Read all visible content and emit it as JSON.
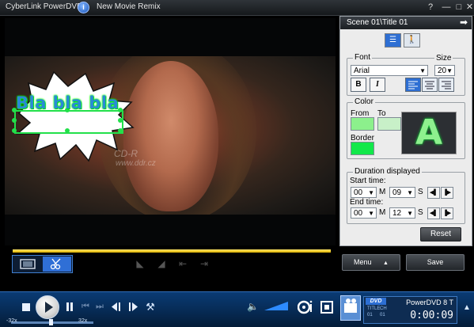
{
  "window": {
    "app_name": "CyberLink PowerDVD",
    "info_icon": "info-icon",
    "document_title": "New Movie Remix",
    "help_label": "?",
    "minimize_label": "—",
    "maximize_label": "□",
    "close_label": "✕"
  },
  "video": {
    "bubble_text": "Bla bla bla",
    "watermark": "www.ddr.cz",
    "watermark_mark": "CD-R"
  },
  "editor": {
    "mode_buttons": [
      "film-strip-icon",
      "scissors-icon"
    ],
    "clip_nav_icons": [
      "set-in-point-icon",
      "set-out-point-icon",
      "go-to-in-point-icon",
      "go-to-out-point-icon"
    ]
  },
  "panel": {
    "header": "Scene 01\\Title 01",
    "next_arrow": "➡",
    "tab_icons": [
      "text-tool-icon",
      "walker-icon"
    ],
    "font_group": {
      "label": "Font",
      "size_label": "Size",
      "font_value": "Arial",
      "size_value": "20",
      "bold_label": "B",
      "italic_label": "I",
      "align_icons": [
        "align-left-icon",
        "align-center-icon",
        "align-right-icon"
      ]
    },
    "color_group": {
      "label": "Color",
      "from_label": "From",
      "to_label": "To",
      "border_label": "Border",
      "from_color": "#8cf08c",
      "to_color": "#c8f0c8",
      "border_color": "#12e84a",
      "preview_letter": "A"
    },
    "duration_group": {
      "label": "Duration displayed",
      "start_label": "Start time:",
      "end_label": "End time:",
      "start_minutes": "00",
      "start_seconds": "09",
      "end_minutes": "00",
      "end_seconds": "12",
      "minutes_unit": "M",
      "seconds_unit": "S"
    },
    "reset_label": "Reset",
    "menu_label": "Menu",
    "menu_arrow": "▲",
    "save_label": "Save"
  },
  "controls": {
    "stop_icon": "stop-icon",
    "play_icon": "play-icon",
    "pause_icon": "pause-icon",
    "prev_icon": "previous-chapter-icon",
    "next_icon": "next-chapter-icon",
    "step_back_icon": "step-backward-icon",
    "step_forward_icon": "step-forward-icon",
    "settings_icon": "tools-icon",
    "volume_icon": "speaker-icon",
    "volume_level": 0.85,
    "speed_min": "-32x",
    "speed_max": "32x",
    "speed_value": 0.48,
    "disc_icon": "disc-info-icon",
    "film_icon": "film-clip-icon",
    "remix_icon": "movie-remix-icon",
    "scroll_icon": "expand-up-icon",
    "info": {
      "logo": "DVD",
      "product": "PowerDVD 8 T",
      "title_label": "TITLE",
      "title_value": "01",
      "chapter_label": "CH",
      "chapter_value": "01",
      "time": "0:00:09"
    }
  }
}
